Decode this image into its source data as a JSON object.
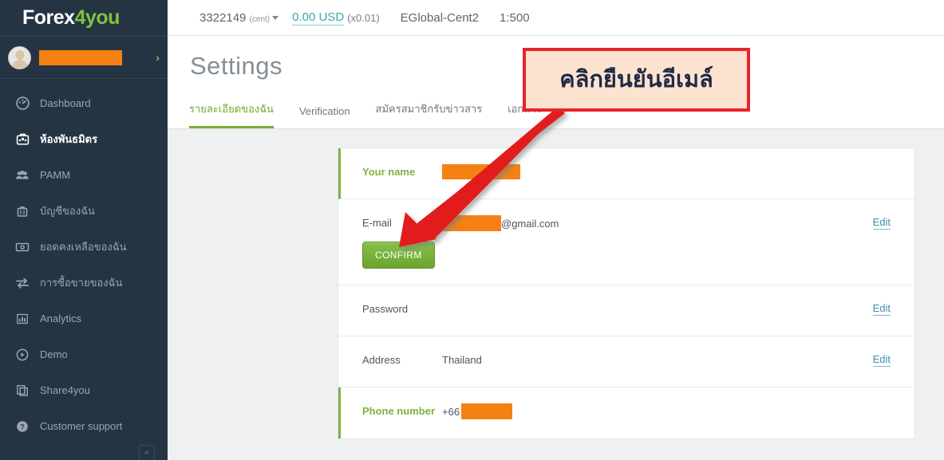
{
  "brand": {
    "text_a": "Forex",
    "text_b": "4you"
  },
  "sidebar": {
    "user": {
      "avatar_name": "user-avatar",
      "name_redacted": "",
      "chevron": "›"
    },
    "items": [
      {
        "label": "Dashboard",
        "icon": "dashboard-icon",
        "active": false
      },
      {
        "label": "ห้องพันธมิตร",
        "icon": "partners-room-icon",
        "active": true
      },
      {
        "label": "PAMM",
        "icon": "pamm-icon",
        "active": false
      },
      {
        "label": "บัญชีของฉัน",
        "icon": "briefcase-icon",
        "active": false
      },
      {
        "label": "ยอดคงเหลือของฉัน",
        "icon": "money-icon",
        "active": false
      },
      {
        "label": "การซื้อขายของฉัน",
        "icon": "transfer-icon",
        "active": false
      },
      {
        "label": "Analytics",
        "icon": "bar-chart-icon",
        "active": false
      },
      {
        "label": "Demo",
        "icon": "play-circle-icon",
        "active": false
      },
      {
        "label": "Share4you",
        "icon": "copy-icon",
        "active": false
      },
      {
        "label": "Customer support",
        "icon": "help-circle-icon",
        "active": false
      }
    ],
    "collapse_label": "«"
  },
  "topbar": {
    "account_number": "3322149",
    "account_unit": "(cent)",
    "balance": "0.00 USD",
    "balance_multiplier": "(x0.01)",
    "server": "EGlobal-Cent2",
    "leverage": "1:500"
  },
  "page": {
    "title": "Settings",
    "tabs": [
      {
        "label": "รายละเอียดของฉัน",
        "active": true
      },
      {
        "label": "Verification",
        "active": false
      },
      {
        "label": "สมัครสมาชิกรับข่าวสาร",
        "active": false
      },
      {
        "label": "เอกสาร",
        "active": false
      }
    ]
  },
  "settings": {
    "name_row": {
      "label": "Your name",
      "value": ""
    },
    "email_row": {
      "label": "E-mail",
      "value_suffix": "@gmail.com",
      "edit": "Edit",
      "confirm_button": "CONFIRM"
    },
    "password_row": {
      "label": "Password",
      "value": "",
      "edit": "Edit"
    },
    "address_row": {
      "label": "Address",
      "value": "Thailand",
      "edit": "Edit"
    },
    "phone_row": {
      "label": "Phone number",
      "value_prefix": "+66"
    }
  },
  "annotation": {
    "text": "คลิกยืนยันอีเมล์",
    "border_color": "#e8232a",
    "fill_color": "#fbe3d0",
    "arrow_color": "#e21d1d"
  },
  "colors": {
    "sidebar_bg": "#253443",
    "brand_green": "#7fc241",
    "accent_green": "#7cb342",
    "link_teal": "#3f8fa8",
    "redaction_orange": "#f58113",
    "content_bg": "#eef0f1"
  }
}
